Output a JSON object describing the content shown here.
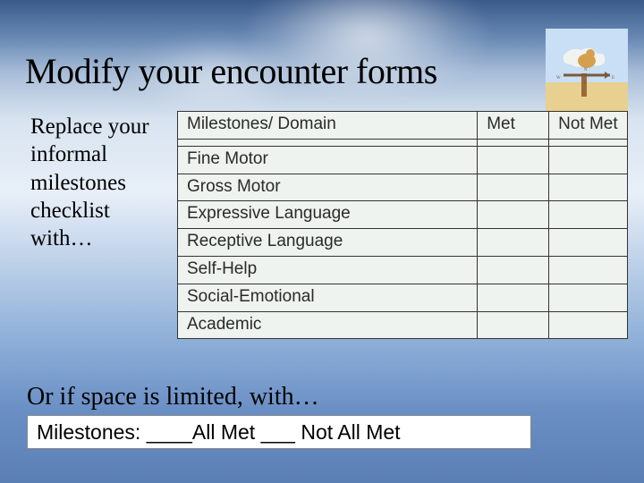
{
  "title": "Modify your encounter forms",
  "intro": "Replace your informal milestones checklist with…",
  "table": {
    "headers": {
      "domain": "Milestones/ Domain",
      "met": "Met",
      "notmet": "Not Met"
    },
    "rows": [
      {
        "domain": "",
        "met": "",
        "notmet": ""
      },
      {
        "domain": "Fine Motor",
        "met": "",
        "notmet": ""
      },
      {
        "domain": "Gross Motor",
        "met": "",
        "notmet": ""
      },
      {
        "domain": "Expressive Language",
        "met": "",
        "notmet": ""
      },
      {
        "domain": "Receptive Language",
        "met": "",
        "notmet": ""
      },
      {
        "domain": "Self-Help",
        "met": "",
        "notmet": ""
      },
      {
        "domain": "Social-Emotional",
        "met": "",
        "notmet": ""
      },
      {
        "domain": "Academic",
        "met": "",
        "notmet": ""
      }
    ]
  },
  "subtitle": "Or if space is limited, with…",
  "inline": "Milestones: ____All Met ___ Not All Met"
}
